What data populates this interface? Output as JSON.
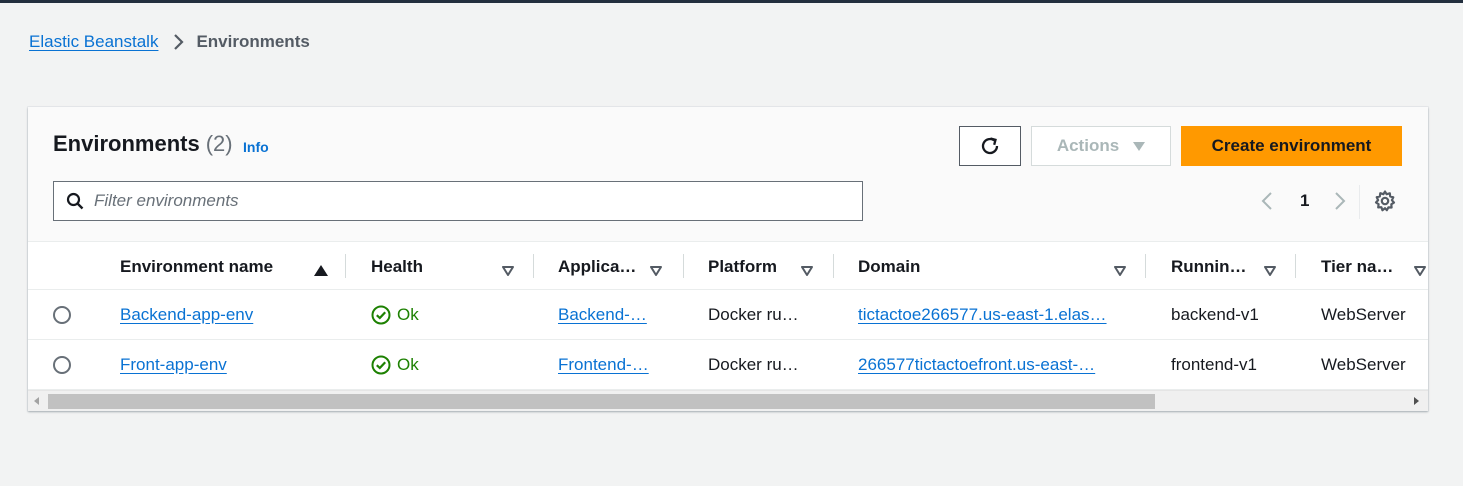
{
  "breadcrumb": {
    "items": [
      "Elastic Beanstalk"
    ],
    "current": "Environments"
  },
  "panel": {
    "title": "Environments",
    "count": "(2)",
    "info_label": "Info",
    "actions_label": "Actions",
    "create_label": "Create environment",
    "filter_placeholder": "Filter environments",
    "page": "1"
  },
  "table": {
    "columns": [
      "Environment name",
      "Health",
      "Applica…",
      "Platform",
      "Domain",
      "Runnin…",
      "Tier na…"
    ],
    "rows": [
      {
        "name": "Backend-app-env",
        "health": "Ok",
        "application": "Backend-…",
        "platform": "Docker ru…",
        "domain": "tictactoe266577.us-east-1.elas…",
        "running_version": "backend-v1",
        "tier": "WebServer"
      },
      {
        "name": "Front-app-env",
        "health": "Ok",
        "application": "Frontend-…",
        "platform": "Docker ru…",
        "domain": "266577tictactoefront.us-east-…",
        "running_version": "frontend-v1",
        "tier": "WebServer"
      }
    ]
  },
  "colors": {
    "link": "#0972d3",
    "primary_button": "#ff9900",
    "health_ok": "#1d8102",
    "page_background": "#f2f3f3"
  },
  "icons": {
    "breadcrumb_separator": "chevron-right-icon",
    "refresh": "refresh-icon",
    "dropdown": "caret-down-icon",
    "search": "search-icon",
    "settings": "gear-icon",
    "sort_ascending": "sort-ascending-icon",
    "filter_column": "sort-caret-icon",
    "health": "check-circle-icon"
  }
}
